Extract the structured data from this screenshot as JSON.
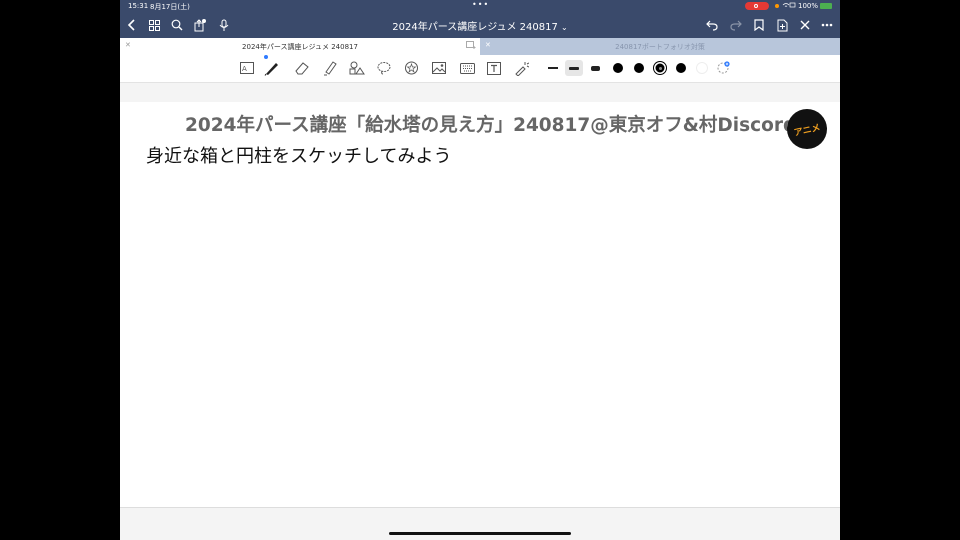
{
  "status_bar": {
    "time": "15:31",
    "date": "8月17日(土)",
    "battery": "100%",
    "multitask_dots": "•••"
  },
  "nav": {
    "title": "2024年パース講座レジュメ 240817",
    "title_chevron": "⌄",
    "icons": [
      "back-icon",
      "grid-icon",
      "search-icon",
      "share-icon",
      "mic-icon",
      "undo-icon",
      "redo-icon",
      "bookmark-icon",
      "add-page-icon",
      "close-icon",
      "more-icon"
    ]
  },
  "tabs": [
    {
      "label": "2024年パース講座レジュメ 240817",
      "active": true
    },
    {
      "label": "240817ポートフォリオ対策",
      "active": false
    }
  ],
  "toolbar": {
    "tools": [
      "lasso-text-icon",
      "pen-icon",
      "eraser-icon",
      "highlighter-icon",
      "shapes-icon",
      "lasso-icon",
      "sticker-icon",
      "image-icon",
      "keyboard-icon",
      "textbox-icon",
      "laser-pointer-icon"
    ],
    "selected_tool": "pen-icon",
    "stroke_sizes": [
      "thin",
      "medium",
      "thick"
    ],
    "selected_stroke": "medium",
    "colors": [
      "#000000",
      "#000000",
      "#000000",
      "#000000"
    ],
    "selected_color_index": 2
  },
  "page": {
    "heading": "2024年パース講座「給水塔の見え方」240817@東京オフ&村Discord",
    "subheading": "身近な箱と円柱をスケッチしてみよう",
    "logo_text": "アニメ"
  },
  "colors": {
    "navbar": "#3a4a6b",
    "tab_inactive": "#b8c6db",
    "recording": "#e53935",
    "accent": "#2f7bff"
  }
}
